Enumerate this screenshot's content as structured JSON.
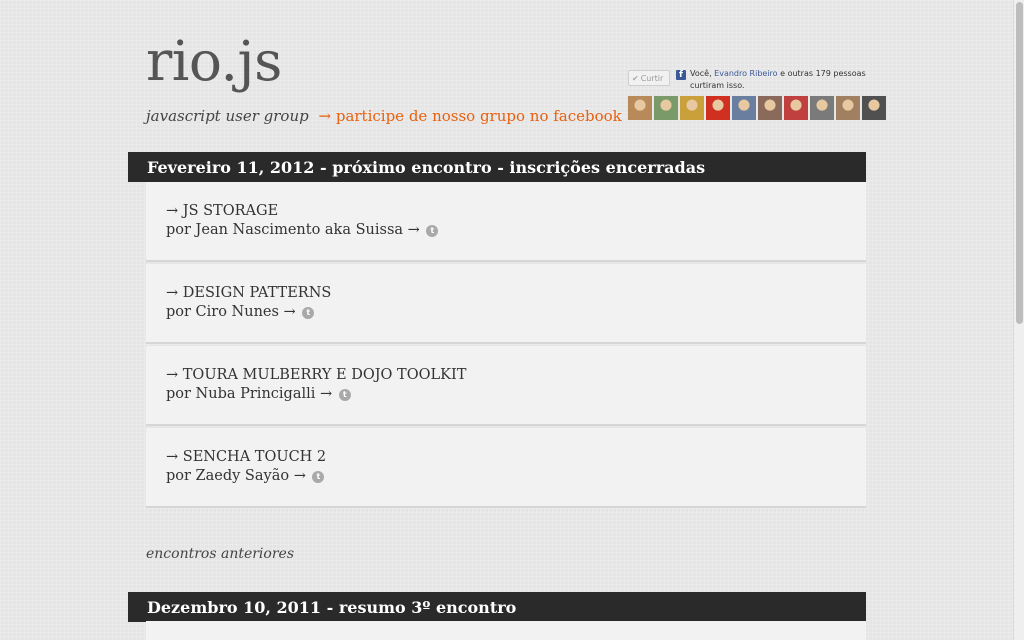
{
  "site": {
    "logo": "rio.js",
    "subtitle": "javascript user group",
    "facebook_link": "→ participe de nosso grupo no facebook"
  },
  "facebook_widget": {
    "like_label": "Curtir",
    "text_prefix": "Você, ",
    "friend_name": "Evandro Ribeiro",
    "text_suffix": " e outras 179 pessoas curtiram isso.",
    "brand_color": "#3b5998",
    "faces": [
      "#b88a5a",
      "#7a9a6a",
      "#c9a03a",
      "#d03020",
      "#6a7fa0",
      "#8a6a5a",
      "#c04040",
      "#7a7a7a",
      "#a08060",
      "#505050"
    ]
  },
  "next_meeting": {
    "header": "Fevereiro 11, 2012 - próximo encontro - inscrições encerradas",
    "talks": [
      {
        "title": "→ JS STORAGE",
        "speaker": "por Jean Nascimento aka Suissa →"
      },
      {
        "title": "→ DESIGN PATTERNS",
        "speaker": "por Ciro Nunes →"
      },
      {
        "title": "→ TOURA MULBERRY E DOJO TOOLKIT",
        "speaker": "por Nuba Princigalli →"
      },
      {
        "title": "→ SENCHA TOUCH 2",
        "speaker": "por Zaedy Sayão →"
      }
    ]
  },
  "previous": {
    "label": "encontros anteriores",
    "header": "Dezembro 10, 2011 - resumo 3º encontro"
  },
  "icons": {
    "twitter": "t",
    "like_check": "✔"
  },
  "colors": {
    "accent": "#e8600f",
    "header_bg": "#2a2a2a",
    "panel_bg": "#f2f2f2"
  }
}
